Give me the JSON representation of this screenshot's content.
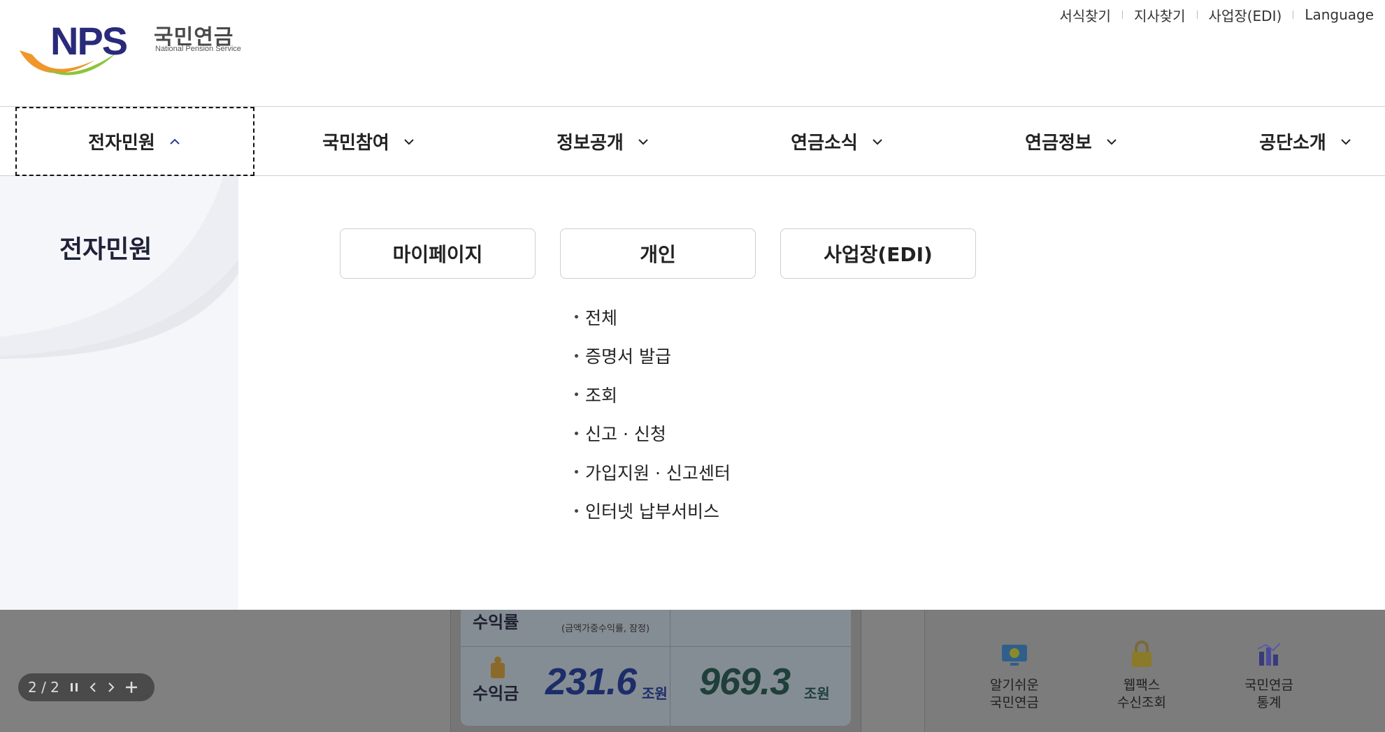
{
  "header": {
    "logo": {
      "mark": "NPS",
      "name_ko": "국민연금",
      "name_en": "National Pension Service",
      "colors": {
        "navy": "#2a2a7a",
        "orange": "#f0962a",
        "green": "#8cc43c"
      }
    },
    "util_links": [
      "서식찾기",
      "지사찾기",
      "사업장(EDI)",
      "Language"
    ]
  },
  "gnb": {
    "items": [
      {
        "label": "전자민원",
        "state": "expanded"
      },
      {
        "label": "국민참여",
        "state": "collapsed"
      },
      {
        "label": "정보공개",
        "state": "collapsed"
      },
      {
        "label": "연금소식",
        "state": "collapsed"
      },
      {
        "label": "연금정보",
        "state": "collapsed"
      },
      {
        "label": "공단소개",
        "state": "collapsed"
      }
    ]
  },
  "mega_menu": {
    "title": "전자민원",
    "buttons": [
      "마이페이지",
      "개인",
      "사업장(EDI)"
    ],
    "sub_items": [
      "전체",
      "증명서 발급",
      "조회",
      "신고 · 신청",
      "가입지원 · 신고센터",
      "인터넷 납부서비스"
    ]
  },
  "background": {
    "pager": {
      "text": "2 / 2",
      "pause_icon": "pause-icon",
      "prev_icon": "chevron-left-icon",
      "next_icon": "chevron-right-icon",
      "plus_icon": "plus-icon"
    },
    "stats": {
      "rate_label": "수익률",
      "rate_note": "(금액가중수익률, 잠정)",
      "profit_label": "수익금",
      "profit_value_1": "231.6",
      "profit_value_2": "969.3",
      "unit": "조원"
    },
    "quick_links": [
      {
        "label_1": "알기쉬운",
        "label_2": "국민연금",
        "icon": "monitor-icon"
      },
      {
        "label_1": "웹팩스",
        "label_2": "수신조회",
        "icon": "lock-icon"
      },
      {
        "label_1": "국민연금",
        "label_2": "통계",
        "icon": "chart-icon"
      }
    ]
  }
}
